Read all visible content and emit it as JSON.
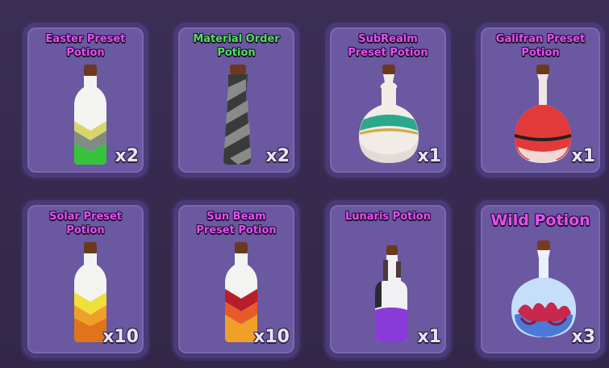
{
  "inventory": {
    "items": [
      {
        "name": "Easter Preset\nPotion",
        "count": "x2"
      },
      {
        "name": "Material Order\nPotion",
        "count": "x2"
      },
      {
        "name": "SubRealm\nPreset Potion",
        "count": "x1"
      },
      {
        "name": "Galifran Preset\nPotion",
        "count": "x1"
      },
      {
        "name": "Solar Preset\nPotion",
        "count": "x10"
      },
      {
        "name": "Sun Beam\nPreset Potion",
        "count": "x10"
      },
      {
        "name": "Lunaris Potion",
        "count": "x1"
      },
      {
        "name": "Wild Potion",
        "count": "x3"
      }
    ]
  },
  "colors": {
    "title_purple": "#e64ff0",
    "title_green": "#52e05a",
    "card_fill": "#6a58a0",
    "card_border": "#4a3b78"
  }
}
